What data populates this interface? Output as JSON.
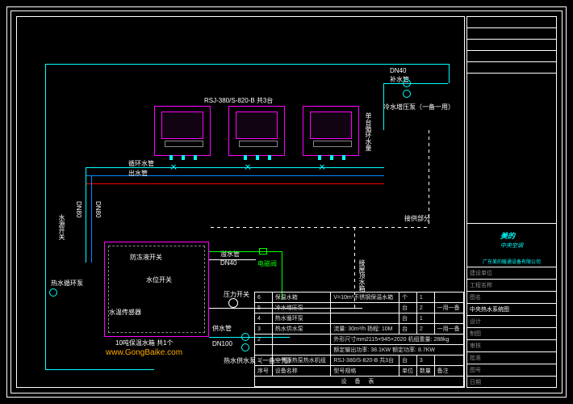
{
  "labels": {
    "hp_model": "RSJ-380/S-820-B 共3台",
    "hp_side_rot": "单台循环水量",
    "dn40": "DN40",
    "supply_pipe": "补水管",
    "cold_pump": "冷水增压泵（一备一用）",
    "return_pipe": "循环水管",
    "out_pipe": "出水管",
    "dn80_a": "DN80",
    "dn80_b": "DN80",
    "left_rot": "水源开关",
    "hot_loop": "热水循环泵",
    "anti_freeze": "防冻液开关",
    "level_sw": "水位开关",
    "sensor": "水温传感器",
    "tank_label": "10吨保温水箱  共1个",
    "watermark": "www.GongBaike.com",
    "drain": "溢水管",
    "dn40_b": "DN40",
    "solenoid": "电磁阀",
    "right_rot": "接屋顶水箱",
    "delivery_note": "接供部分",
    "pressure": "压力开关",
    "supply_pipe2": "供水管",
    "dn100": "DN100",
    "hot_supply_pump": "热水供水泵（一备一用）"
  },
  "equipment_table": {
    "title": "设 备 表",
    "header": [
      "序号",
      "设备名称",
      "型号规格",
      "单位",
      "数量",
      "备注"
    ],
    "rows": [
      [
        "6",
        "保温水箱",
        "V=10m³不锈钢保温水箱",
        "个",
        "1",
        ""
      ],
      [
        "5",
        "冷水增压泵",
        "",
        "台",
        "2",
        "一用一备"
      ],
      [
        "4",
        "热水循环泵",
        "",
        "台",
        "1",
        ""
      ],
      [
        "3",
        "热水供水泵",
        "流量: 30m³/h 扬程: 10M",
        "台",
        "2",
        "一用一备"
      ],
      [
        "2",
        "",
        "外形尺寸mm2115×945×2020 机组重量: 288kg",
        "",
        "",
        ""
      ],
      [
        "",
        "",
        "额定输出功率: 38.1KW 额定功率: 8.7KW",
        "",
        "",
        ""
      ],
      [
        "1",
        "空气源热泵热水机组",
        "RSJ-380/S-820-B 共3台",
        "台",
        "3",
        ""
      ]
    ]
  },
  "title_block": {
    "brand": "美的",
    "sub": "中央空调",
    "company": "广东美的暖通设备有限公司",
    "rows": [
      "建设单位",
      "工程名称",
      "图名",
      "设计",
      "制图",
      "审核",
      "批准",
      "图号",
      "日期"
    ],
    "drawing_no": "中央热水系统图",
    "meta_rows": [
      "",
      "",
      "",
      "",
      "",
      ""
    ]
  }
}
